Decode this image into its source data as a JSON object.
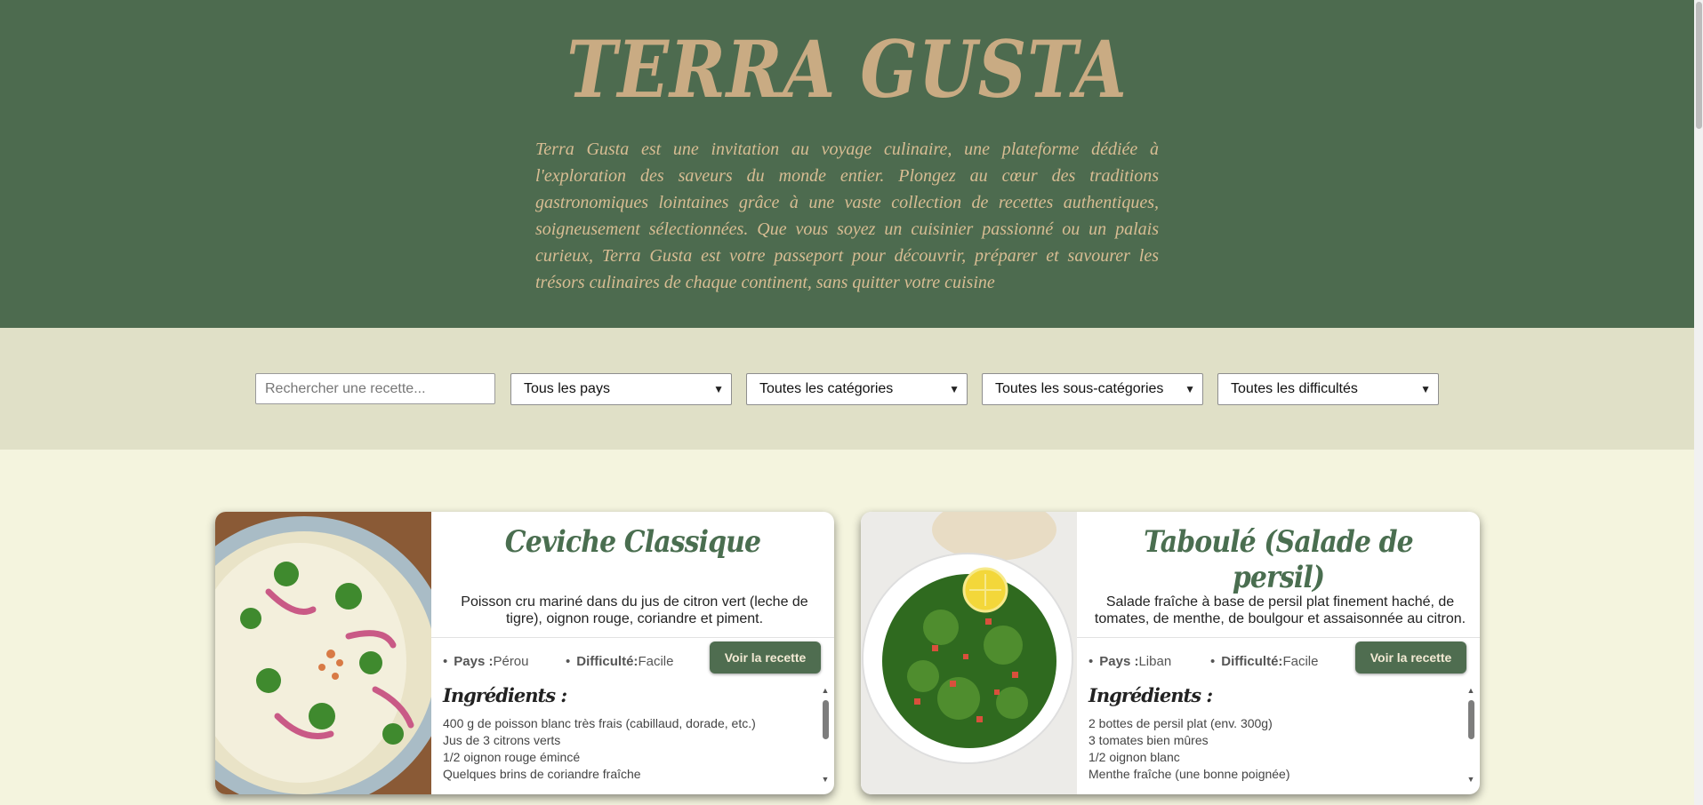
{
  "header": {
    "brand": "TERRA GUSTA",
    "intro": "Terra Gusta est une invitation au voyage culinaire, une plateforme dédiée à l'exploration des saveurs du monde entier. Plongez au cœur des traditions gastronomiques lointaines grâce à une vaste collection de recettes authentiques, soigneusement sélectionnées. Que vous soyez un cuisinier passionné ou un palais curieux, Terra Gusta est votre passeport pour découvrir, préparer et savourer les trésors culinaires de chaque continent, sans quitter votre cuisine"
  },
  "filters": {
    "search_placeholder": "Rechercher une recette...",
    "country": "Tous les pays",
    "category": "Toutes les catégories",
    "subcategory": "Toutes les sous-catégories",
    "difficulty": "Toutes les difficultés"
  },
  "recipes": [
    {
      "title": "Ceviche Classique",
      "description": "Poisson cru mariné dans du jus de citron vert (leche de tigre), oignon rouge, coriandre et piment.",
      "country_label": "Pays :",
      "country": "Pérou",
      "difficulty_label": "Difficulté:",
      "difficulty": "Facile",
      "button": "Voir la recette",
      "ingredients_title": "Ingrédients :",
      "ingredients": [
        "400 g de poisson blanc très frais (cabillaud, dorade, etc.)",
        "Jus de 3 citrons verts",
        "1/2 oignon rouge émincé",
        "Quelques brins de coriandre fraîche"
      ]
    },
    {
      "title": "Taboulé (Salade de persil)",
      "description": "Salade fraîche à base de persil plat finement haché, de tomates, de menthe, de boulgour et assaisonnée au citron.",
      "country_label": "Pays :",
      "country": "Liban",
      "difficulty_label": "Difficulté:",
      "difficulty": "Facile",
      "button": "Voir la recette",
      "ingredients_title": "Ingrédients :",
      "ingredients": [
        "2 bottes de persil plat (env. 300g)",
        "3 tomates bien mûres",
        "1/2 oignon blanc",
        "Menthe fraîche (une bonne poignée)"
      ]
    }
  ],
  "colors": {
    "hero_bg": "#4d6b4f",
    "brand": "#c9ab83",
    "filter_bg": "#e0e0c7",
    "page_bg": "#f4f4de",
    "accent_button": "#4f6d50"
  }
}
